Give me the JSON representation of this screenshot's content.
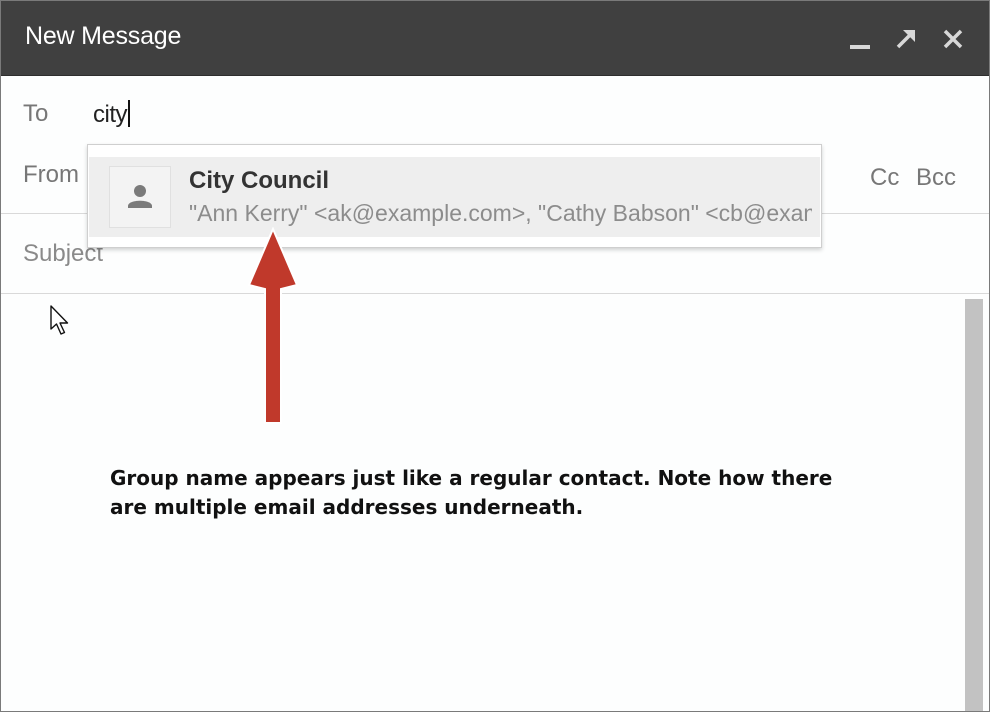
{
  "window": {
    "title": "New Message",
    "controls": {
      "minimize_icon": "minimize-icon",
      "popout_icon": "pop-out-icon",
      "close_icon": "close-icon"
    }
  },
  "compose": {
    "to_label": "To",
    "to_value": "city",
    "from_label": "From",
    "cc_label": "Cc",
    "bcc_label": "Bcc",
    "subject_label": "Subject"
  },
  "suggestion": {
    "avatar_icon": "person-icon",
    "name": "City Council",
    "emails": "\"Ann Kerry\" <ak@example.com>, \"Cathy Babson\" <cb@example.com>"
  },
  "annotation": {
    "text": "Group name appears just like a regular contact. Note how there are multiple email addresses underneath.",
    "arrow_color": "#c0392b"
  },
  "colors": {
    "titlebar": "#404040",
    "label": "#777777"
  }
}
